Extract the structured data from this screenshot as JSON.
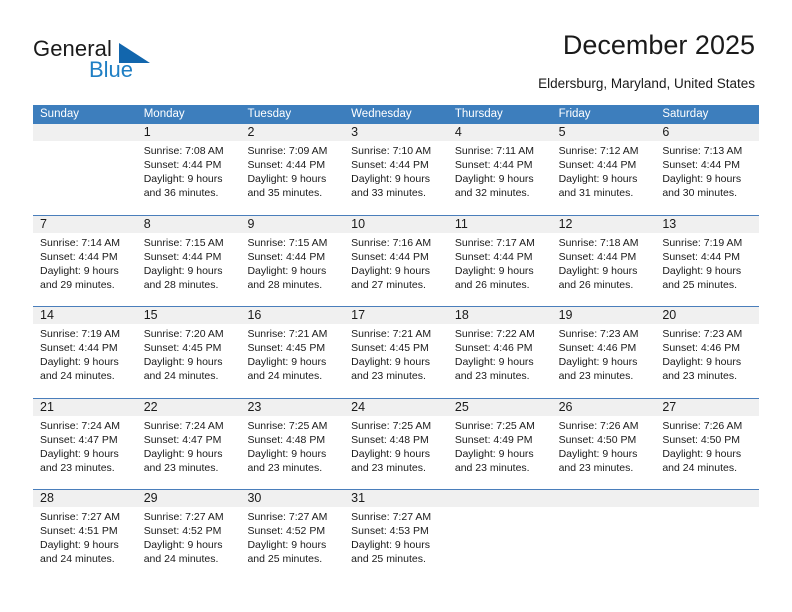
{
  "logo": {
    "word_one": "General",
    "word_two": "Blue",
    "triangle_color": "#1266ad",
    "blue_color": "#1f7fc4"
  },
  "header": {
    "title": "December 2025",
    "location": "Eldersburg, Maryland, United States"
  },
  "theme": {
    "header_bg": "#3d7ebd",
    "header_text": "#ffffff",
    "daynum_band": "#f0f0f0",
    "week_divider": "#4a7ebb",
    "text": "#1a1a1a"
  },
  "calendar": {
    "day_headers": [
      "Sunday",
      "Monday",
      "Tuesday",
      "Wednesday",
      "Thursday",
      "Friday",
      "Saturday"
    ],
    "weeks": [
      [
        {
          "day": "",
          "lines": []
        },
        {
          "day": "1",
          "lines": [
            "Sunrise: 7:08 AM",
            "Sunset: 4:44 PM",
            "Daylight: 9 hours",
            "and 36 minutes."
          ]
        },
        {
          "day": "2",
          "lines": [
            "Sunrise: 7:09 AM",
            "Sunset: 4:44 PM",
            "Daylight: 9 hours",
            "and 35 minutes."
          ]
        },
        {
          "day": "3",
          "lines": [
            "Sunrise: 7:10 AM",
            "Sunset: 4:44 PM",
            "Daylight: 9 hours",
            "and 33 minutes."
          ]
        },
        {
          "day": "4",
          "lines": [
            "Sunrise: 7:11 AM",
            "Sunset: 4:44 PM",
            "Daylight: 9 hours",
            "and 32 minutes."
          ]
        },
        {
          "day": "5",
          "lines": [
            "Sunrise: 7:12 AM",
            "Sunset: 4:44 PM",
            "Daylight: 9 hours",
            "and 31 minutes."
          ]
        },
        {
          "day": "6",
          "lines": [
            "Sunrise: 7:13 AM",
            "Sunset: 4:44 PM",
            "Daylight: 9 hours",
            "and 30 minutes."
          ]
        }
      ],
      [
        {
          "day": "7",
          "lines": [
            "Sunrise: 7:14 AM",
            "Sunset: 4:44 PM",
            "Daylight: 9 hours",
            "and 29 minutes."
          ]
        },
        {
          "day": "8",
          "lines": [
            "Sunrise: 7:15 AM",
            "Sunset: 4:44 PM",
            "Daylight: 9 hours",
            "and 28 minutes."
          ]
        },
        {
          "day": "9",
          "lines": [
            "Sunrise: 7:15 AM",
            "Sunset: 4:44 PM",
            "Daylight: 9 hours",
            "and 28 minutes."
          ]
        },
        {
          "day": "10",
          "lines": [
            "Sunrise: 7:16 AM",
            "Sunset: 4:44 PM",
            "Daylight: 9 hours",
            "and 27 minutes."
          ]
        },
        {
          "day": "11",
          "lines": [
            "Sunrise: 7:17 AM",
            "Sunset: 4:44 PM",
            "Daylight: 9 hours",
            "and 26 minutes."
          ]
        },
        {
          "day": "12",
          "lines": [
            "Sunrise: 7:18 AM",
            "Sunset: 4:44 PM",
            "Daylight: 9 hours",
            "and 26 minutes."
          ]
        },
        {
          "day": "13",
          "lines": [
            "Sunrise: 7:19 AM",
            "Sunset: 4:44 PM",
            "Daylight: 9 hours",
            "and 25 minutes."
          ]
        }
      ],
      [
        {
          "day": "14",
          "lines": [
            "Sunrise: 7:19 AM",
            "Sunset: 4:44 PM",
            "Daylight: 9 hours",
            "and 24 minutes."
          ]
        },
        {
          "day": "15",
          "lines": [
            "Sunrise: 7:20 AM",
            "Sunset: 4:45 PM",
            "Daylight: 9 hours",
            "and 24 minutes."
          ]
        },
        {
          "day": "16",
          "lines": [
            "Sunrise: 7:21 AM",
            "Sunset: 4:45 PM",
            "Daylight: 9 hours",
            "and 24 minutes."
          ]
        },
        {
          "day": "17",
          "lines": [
            "Sunrise: 7:21 AM",
            "Sunset: 4:45 PM",
            "Daylight: 9 hours",
            "and 23 minutes."
          ]
        },
        {
          "day": "18",
          "lines": [
            "Sunrise: 7:22 AM",
            "Sunset: 4:46 PM",
            "Daylight: 9 hours",
            "and 23 minutes."
          ]
        },
        {
          "day": "19",
          "lines": [
            "Sunrise: 7:23 AM",
            "Sunset: 4:46 PM",
            "Daylight: 9 hours",
            "and 23 minutes."
          ]
        },
        {
          "day": "20",
          "lines": [
            "Sunrise: 7:23 AM",
            "Sunset: 4:46 PM",
            "Daylight: 9 hours",
            "and 23 minutes."
          ]
        }
      ],
      [
        {
          "day": "21",
          "lines": [
            "Sunrise: 7:24 AM",
            "Sunset: 4:47 PM",
            "Daylight: 9 hours",
            "and 23 minutes."
          ]
        },
        {
          "day": "22",
          "lines": [
            "Sunrise: 7:24 AM",
            "Sunset: 4:47 PM",
            "Daylight: 9 hours",
            "and 23 minutes."
          ]
        },
        {
          "day": "23",
          "lines": [
            "Sunrise: 7:25 AM",
            "Sunset: 4:48 PM",
            "Daylight: 9 hours",
            "and 23 minutes."
          ]
        },
        {
          "day": "24",
          "lines": [
            "Sunrise: 7:25 AM",
            "Sunset: 4:48 PM",
            "Daylight: 9 hours",
            "and 23 minutes."
          ]
        },
        {
          "day": "25",
          "lines": [
            "Sunrise: 7:25 AM",
            "Sunset: 4:49 PM",
            "Daylight: 9 hours",
            "and 23 minutes."
          ]
        },
        {
          "day": "26",
          "lines": [
            "Sunrise: 7:26 AM",
            "Sunset: 4:50 PM",
            "Daylight: 9 hours",
            "and 23 minutes."
          ]
        },
        {
          "day": "27",
          "lines": [
            "Sunrise: 7:26 AM",
            "Sunset: 4:50 PM",
            "Daylight: 9 hours",
            "and 24 minutes."
          ]
        }
      ],
      [
        {
          "day": "28",
          "lines": [
            "Sunrise: 7:27 AM",
            "Sunset: 4:51 PM",
            "Daylight: 9 hours",
            "and 24 minutes."
          ]
        },
        {
          "day": "29",
          "lines": [
            "Sunrise: 7:27 AM",
            "Sunset: 4:52 PM",
            "Daylight: 9 hours",
            "and 24 minutes."
          ]
        },
        {
          "day": "30",
          "lines": [
            "Sunrise: 7:27 AM",
            "Sunset: 4:52 PM",
            "Daylight: 9 hours",
            "and 25 minutes."
          ]
        },
        {
          "day": "31",
          "lines": [
            "Sunrise: 7:27 AM",
            "Sunset: 4:53 PM",
            "Daylight: 9 hours",
            "and 25 minutes."
          ]
        },
        {
          "day": "",
          "lines": []
        },
        {
          "day": "",
          "lines": []
        },
        {
          "day": "",
          "lines": []
        }
      ]
    ]
  }
}
